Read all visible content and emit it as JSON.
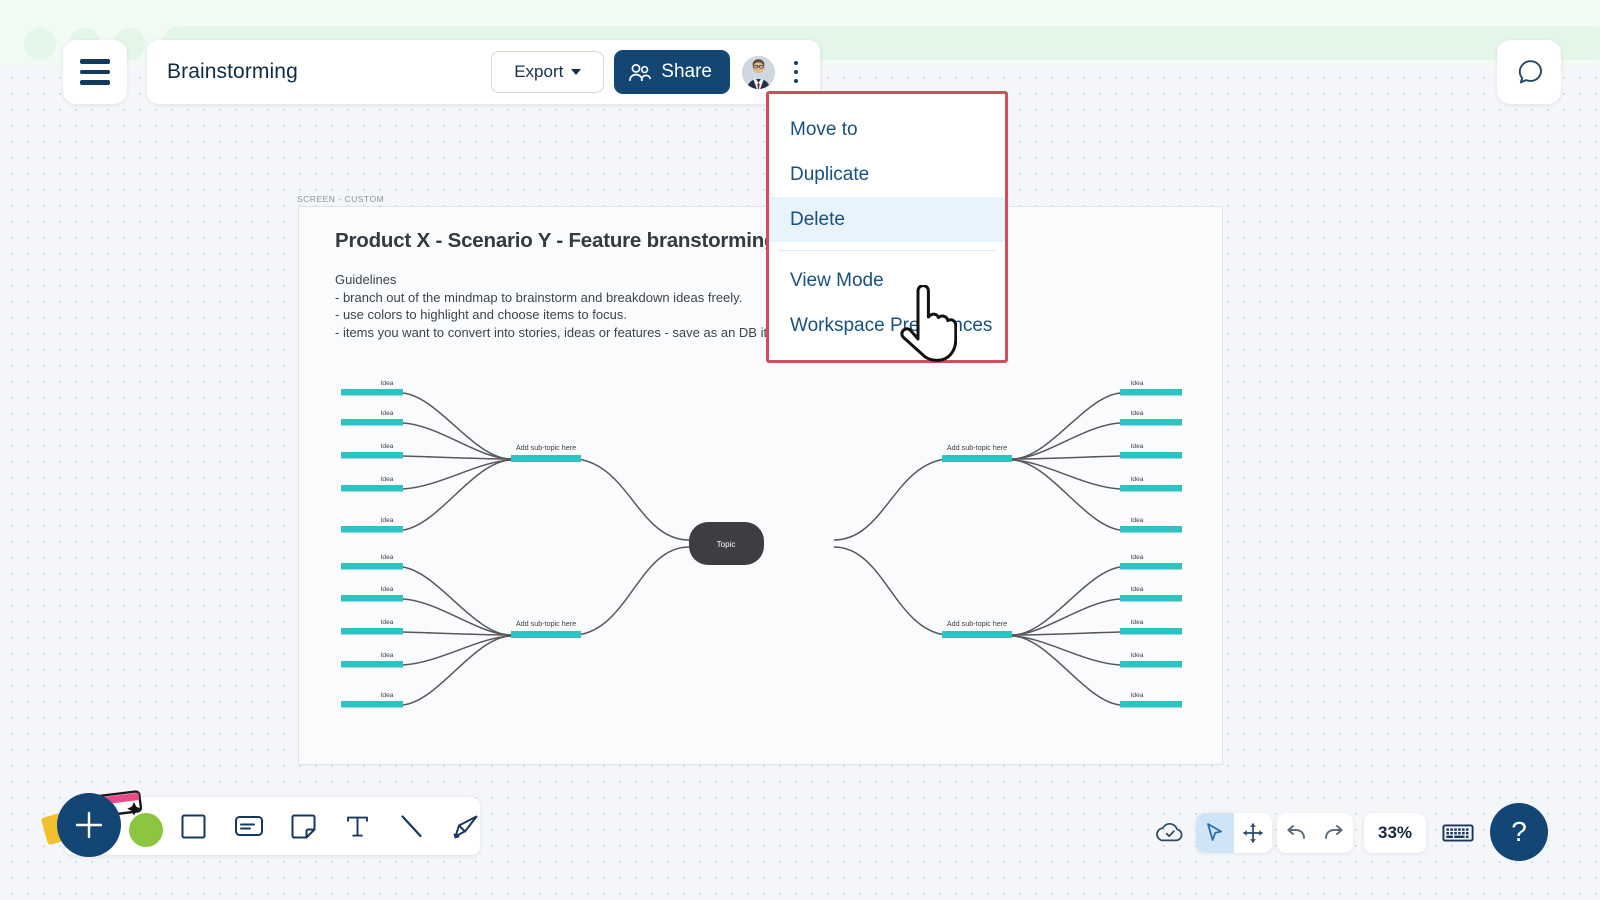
{
  "browser": {
    "dots": 3,
    "url_value": "",
    "url_placeholder": ""
  },
  "topbar": {
    "menu_icon": "hamburger-icon",
    "doc_title": "Brainstorming",
    "export_label": "Export",
    "export_caret_icon": "chevron-down-icon",
    "share_label": "Share",
    "share_icon": "users-icon",
    "avatar_icon": "user-avatar",
    "kebab_icon": "more-vertical-icon",
    "comment_icon": "comment-bubble-icon"
  },
  "dropdown": {
    "items": [
      {
        "label": "Move to",
        "active": false
      },
      {
        "label": "Duplicate",
        "active": false
      },
      {
        "label": "Delete",
        "active": true
      },
      {
        "label": "View Mode",
        "active": false
      },
      {
        "label": "Workspace Preferences",
        "active": false
      }
    ],
    "separator_after_index": 2,
    "border_color": "#d64b5c",
    "highlight_color": "#e9f3fc",
    "text_color": "#19507e"
  },
  "cursor": {
    "icon": "pointing-hand-cursor"
  },
  "frame": {
    "label": "SCREEN - CUSTOM",
    "title": "Product X - Scenario Y - Feature branstorming mindmap",
    "guidelines": "Guidelines\n- branch out of the mindmap to brainstorm and breakdown ideas freely.\n- use colors to highlight and choose items to focus.\n- items you want to convert into stories, ideas or features - save as an DB item."
  },
  "mindmap": {
    "center_label": "Topic",
    "center_color": "#3e3e42",
    "branch_color": "#2ec2c2",
    "edge_color": "#55585c",
    "branch_label": "Add sub-topic here",
    "leaf_label": "Idea",
    "branches": [
      {
        "name": "top-left",
        "label": "Add sub-topic here",
        "leaves": [
          "Idea",
          "Idea",
          "Idea",
          "Idea",
          "Idea"
        ]
      },
      {
        "name": "bottom-left",
        "label": "Add sub-topic here",
        "leaves": [
          "Idea",
          "Idea",
          "Idea",
          "Idea",
          "Idea"
        ]
      },
      {
        "name": "top-right",
        "label": "Add sub-topic here",
        "leaves": [
          "Idea",
          "Idea",
          "Idea",
          "Idea",
          "Idea"
        ]
      },
      {
        "name": "bottom-right",
        "label": "Add sub-topic here",
        "leaves": [
          "Idea",
          "Idea",
          "Idea",
          "Idea",
          "Idea"
        ]
      }
    ]
  },
  "toolbar": {
    "add_label": "+",
    "tools": [
      {
        "name": "shape-square-icon",
        "label": "Shape"
      },
      {
        "name": "card-icon",
        "label": "Card"
      },
      {
        "name": "sticky-note-icon",
        "label": "Sticky note"
      },
      {
        "name": "text-icon",
        "label": "Text"
      },
      {
        "name": "line-icon",
        "label": "Line"
      },
      {
        "name": "highlighter-icon",
        "label": "Draw"
      }
    ]
  },
  "bottom_right": {
    "save_status_icon": "cloud-check-icon",
    "select_tool_icon": "cursor-arrow-icon",
    "pan_tool_icon": "move-arrows-icon",
    "undo_icon": "undo-arrow-icon",
    "redo_icon": "redo-arrow-icon",
    "zoom_level": "33%",
    "keyboard_icon": "keyboard-icon",
    "help_label": "?",
    "active_tool": "select"
  }
}
